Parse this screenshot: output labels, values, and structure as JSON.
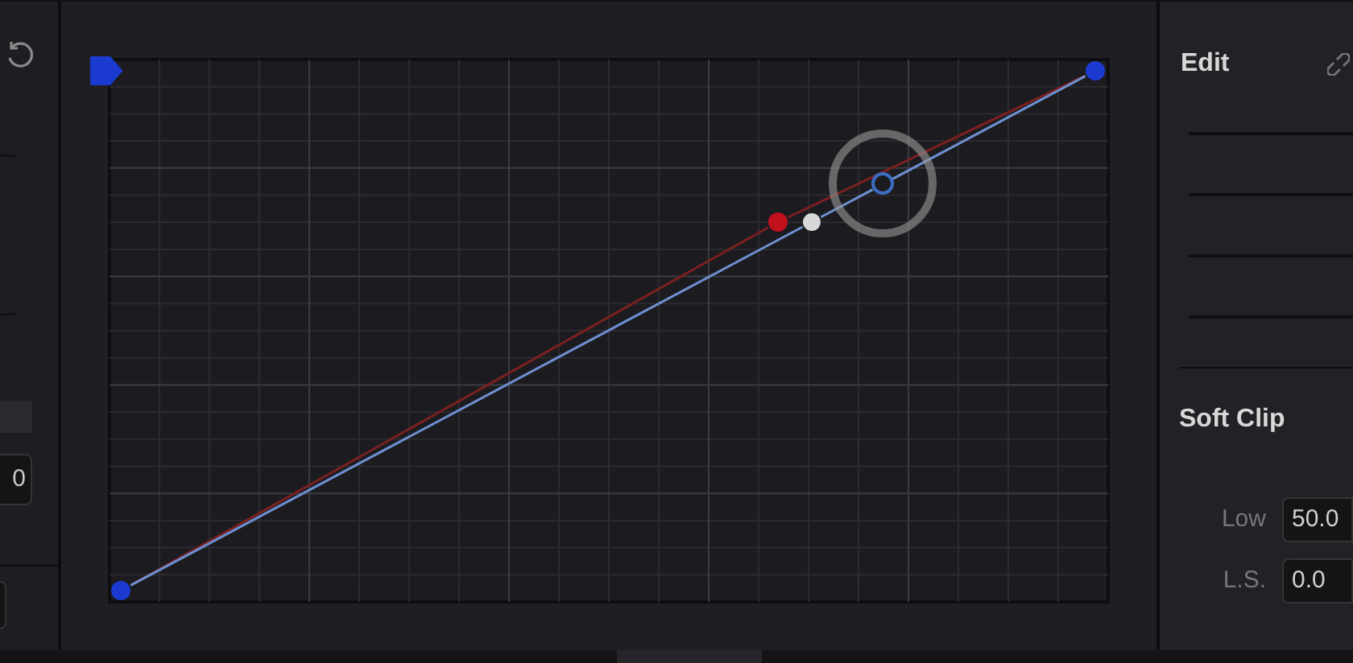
{
  "left_panel": {
    "field_value": "0"
  },
  "right_panel": {
    "title": "Edit",
    "section": "Soft Clip",
    "fields": [
      {
        "label": "Low",
        "value": "50.0"
      },
      {
        "label": "L.S.",
        "value": "0.0"
      }
    ]
  }
}
